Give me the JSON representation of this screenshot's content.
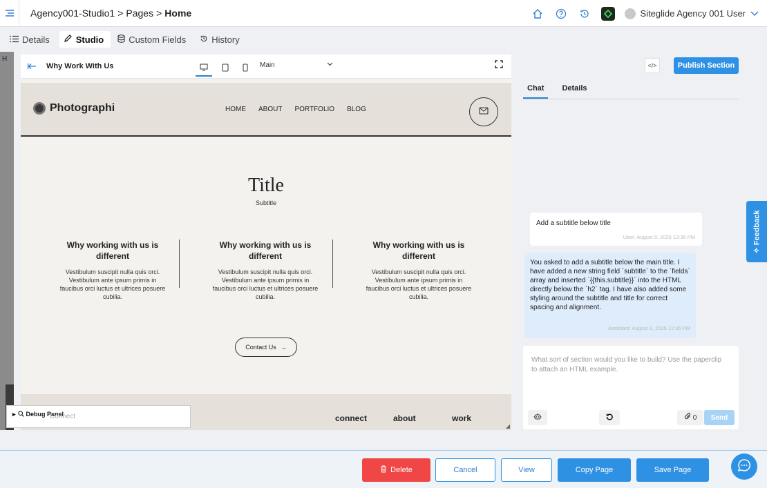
{
  "header": {
    "crumb_1": "Agency001-Studio1",
    "crumb_sep_1": ">",
    "crumb_2": "Pages",
    "crumb_sep_2": ">",
    "crumb_3": "Home",
    "user_name": "Siteglide Agency 001 User"
  },
  "tabs": [
    {
      "label": "Details",
      "icon": "list-icon"
    },
    {
      "label": "Studio",
      "icon": "pen-icon"
    },
    {
      "label": "Custom Fields",
      "icon": "database-icon"
    },
    {
      "label": "History",
      "icon": "history-icon"
    }
  ],
  "rail_letter": "H",
  "canvas_toolbar": {
    "section_name": "Why Work With Us",
    "view_select": "Main"
  },
  "site": {
    "logo": "Photographi",
    "nav": [
      "HOME",
      "ABOUT",
      "PORTFOLIO",
      "BLOG"
    ],
    "title": "Title",
    "subtitle": "Subtitle",
    "columns": [
      {
        "heading": "Why working with us is different",
        "body": "Vestibulum suscipit nulla quis orci. Vestibulum ante ipsum primis in faucibus orci luctus et ultrices posuere cubilia."
      },
      {
        "heading": "Why working with us is different",
        "body": "Vestibulum suscipit nulla quis orci. Vestibulum ante ipsum primis in faucibus orci luctus et ultrices posuere cubilia."
      },
      {
        "heading": "Why working with us is different",
        "body": "Vestibulum suscipit nulla quis orci. Vestibulum ante ipsum primis in faucibus orci luctus et ultrices posuere cubilia."
      }
    ],
    "contact_label": "Contact Us",
    "contact_arrow": "→",
    "footer_links": [
      "connect",
      "about",
      "work"
    ]
  },
  "debug": {
    "label": "Debug Panel",
    "ghost_text": "Connect"
  },
  "right_panel": {
    "code_label": "</>",
    "publish_label": "Publish Section",
    "tabs": [
      "Chat",
      "Details"
    ],
    "messages": [
      {
        "text": "Add a subtitle below title",
        "meta": "User: August 8, 2025 12:36 PM"
      },
      {
        "text": "You asked to add a subtitle below the main title. I have added a new string field `subtitle` to the `fields` array and inserted `{{this.subtitle}}` into the HTML directly below the `h2` tag. I have also added some styling around the subtitle and title for correct spacing and alignment.",
        "meta": "Assistant: August 8, 2025 12:36 PM"
      }
    ],
    "composer_placeholder": "What sort of section would you like to build? Use the paperclip to attach an HTML example.",
    "attach_count": "0",
    "send_label": "Send"
  },
  "feedback_label": "✧ Feedback",
  "bottom_bar": {
    "delete_label": "Delete",
    "cancel_label": "Cancel",
    "view_label": "View",
    "copy_label": "Copy Page",
    "save_label": "Save Page"
  },
  "colors": {
    "accent": "#2f91e4",
    "danger": "#f04646",
    "assistant_bubble": "#deecfb"
  }
}
